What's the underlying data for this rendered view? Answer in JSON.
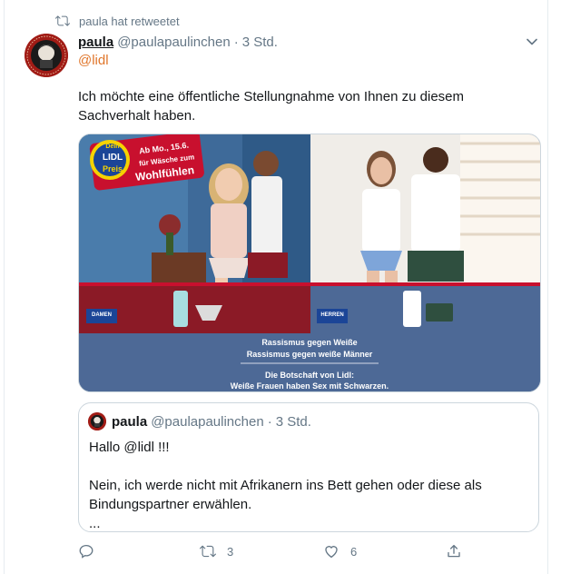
{
  "retweet_note": "paula hat retweetet",
  "tweet": {
    "display_name": "paula",
    "handle": "@paulapaulinchen",
    "separator": "·",
    "time": "3 Std.",
    "reply_to": "@lidl",
    "text": "Ich möchte eine öffentliche Stellungnahme von Ihnen zu diesem Sachverhalt haben."
  },
  "media": {
    "badge_line1": "Dein",
    "badge_brand": "LIDL",
    "badge_line2": "Preis",
    "promo_line1": "Ab Mo., 15.6.",
    "promo_line2": "für Wäsche zum",
    "promo_line3": "Wohlfühlen",
    "label_damen": "DAMEN",
    "label_herren": "HERREN",
    "caption_1": "Rassismus gegen Weiße",
    "caption_2": "Rassismus gegen weiße Männer",
    "caption_3": "Die Botschaft von Lidl:",
    "caption_4": "Weiße Frauen haben Sex mit Schwarzen."
  },
  "quote": {
    "display_name": "paula",
    "handle": "@paulapaulinchen",
    "separator": "·",
    "time": "3 Std.",
    "text": "Hallo @lidl !!!\n\nNein, ich werde nicht mit Afrikanern ins Bett gehen oder diese als Bindungspartner erwählen.\n..."
  },
  "actions": {
    "reply_count": "",
    "retweet_count": "3",
    "like_count": "6"
  },
  "colors": {
    "accent": "#1da1f2",
    "mention": "#e0762b",
    "muted": "#657786",
    "panel_blue": "#4d6996",
    "panel_red": "#8b1a26"
  }
}
